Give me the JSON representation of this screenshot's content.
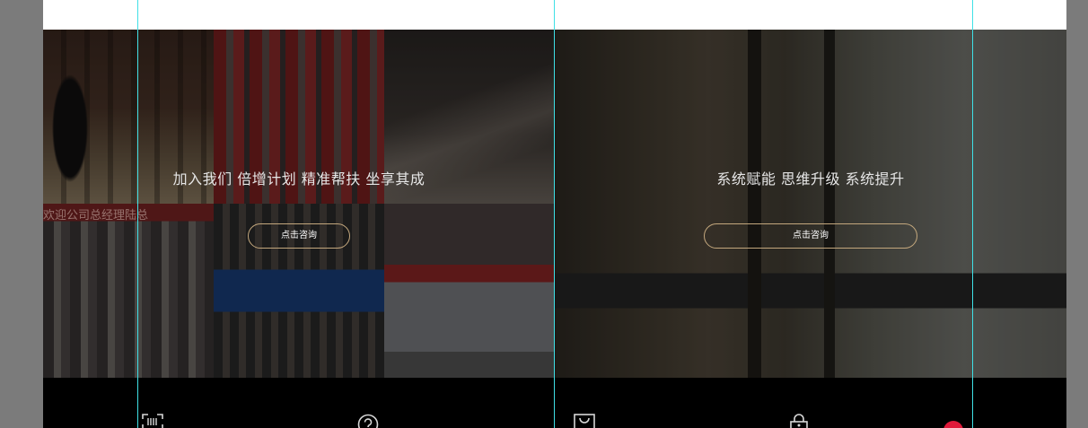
{
  "banners": [
    {
      "headline": "加入我们 倍增计划 精准帮扶 坐享其成",
      "button_label": "点击咨询",
      "photo_sign_text": "欢迎公司总经理陆总"
    },
    {
      "headline": "系统赋能 思维升级 系统提升",
      "button_label": "点击咨询"
    }
  ],
  "footer": {
    "icons": [
      "scan-icon",
      "help-icon",
      "bag-icon",
      "lock-icon",
      "notification-badge"
    ]
  },
  "colors": {
    "button_border": "#c3a77d",
    "guide_line": "#3fe0e6",
    "badge": "#e0193a",
    "footer_bg": "#000000"
  }
}
